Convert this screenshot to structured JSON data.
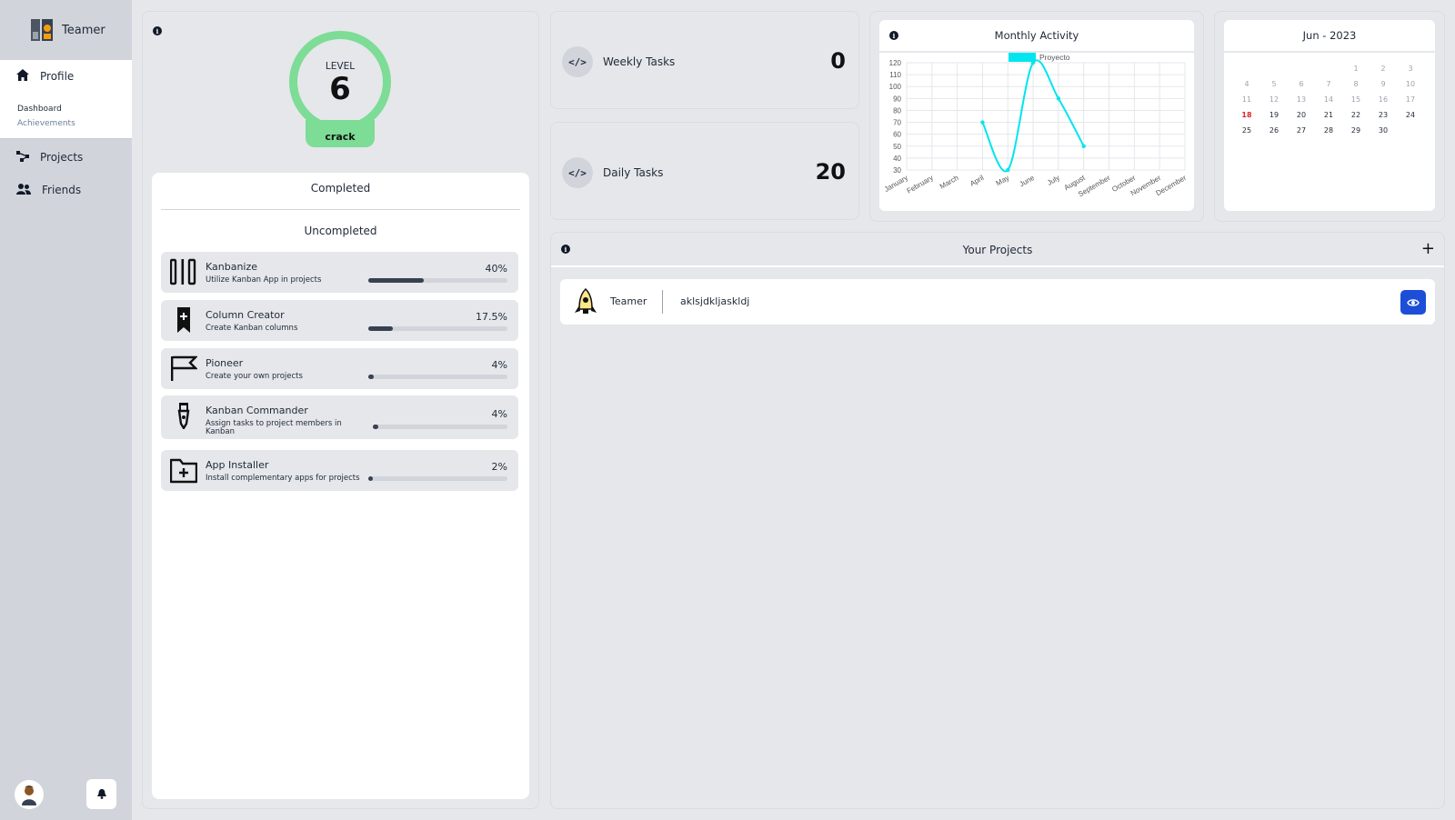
{
  "sidebar": {
    "brand": "Teamer",
    "nav": {
      "profile": "Profile",
      "dashboard": "Dashboard",
      "achievements": "Achievements",
      "projects": "Projects",
      "friends": "Friends"
    }
  },
  "level": {
    "label": "LEVEL",
    "value": "6",
    "rank": "crack"
  },
  "achievements": {
    "tabs": {
      "completed": "Completed",
      "uncompleted": "Uncompleted"
    },
    "items": [
      {
        "title": "Kanbanize",
        "desc": "Utilize Kanban App in projects",
        "pct": "40%",
        "progress": 0.4,
        "icon": "kanban-columns-icon"
      },
      {
        "title": "Column Creator",
        "desc": "Create Kanban columns",
        "pct": "17.5%",
        "progress": 0.175,
        "icon": "bookmark-plus-icon"
      },
      {
        "title": "Pioneer",
        "desc": "Create your own projects",
        "pct": "4%",
        "progress": 0.04,
        "icon": "flag-icon"
      },
      {
        "title": "Kanban Commander",
        "desc": "Assign tasks to project members in Kanban",
        "pct": "4%",
        "progress": 0.04,
        "icon": "medal-icon"
      },
      {
        "title": "App Installer",
        "desc": "Install complementary apps for projects",
        "pct": "2%",
        "progress": 0.02,
        "icon": "folder-plus-icon"
      }
    ]
  },
  "tasks": {
    "weekly": {
      "label": "Weekly Tasks",
      "value": "0"
    },
    "daily": {
      "label": "Daily Tasks",
      "value": "20"
    }
  },
  "chart_data": {
    "type": "line",
    "title": "Monthly Activity",
    "x": [
      "January",
      "February",
      "March",
      "April",
      "May",
      "June",
      "July",
      "August",
      "September",
      "October",
      "November",
      "December"
    ],
    "series": [
      {
        "name": "Proyecto",
        "values": [
          null,
          null,
          null,
          70,
          30,
          120,
          90,
          50,
          null,
          null,
          null,
          null
        ]
      }
    ],
    "ylim": [
      30,
      120
    ],
    "yticks": [
      30,
      40,
      50,
      60,
      70,
      80,
      90,
      100,
      110,
      120
    ],
    "grid": true,
    "legend": "top",
    "color": "#00e5ee"
  },
  "calendar": {
    "title": "Jun - 2023",
    "today": 18,
    "weeks": [
      [
        "",
        "",
        "",
        "",
        "1",
        "2",
        "3"
      ],
      [
        "4",
        "5",
        "6",
        "7",
        "8",
        "9",
        "10"
      ],
      [
        "11",
        "12",
        "13",
        "14",
        "15",
        "16",
        "17"
      ],
      [
        "18",
        "19",
        "20",
        "21",
        "22",
        "23",
        "24"
      ],
      [
        "25",
        "26",
        "27",
        "28",
        "29",
        "30",
        ""
      ]
    ]
  },
  "projects": {
    "title": "Your Projects",
    "add": "+",
    "items": [
      {
        "name": "Teamer",
        "desc": "aklsjdkljaskldj"
      }
    ]
  },
  "colors": {
    "accent": "#7ddc95",
    "chart_line": "#00e5ee",
    "view_button": "#1d4ed8",
    "today": "#dc2626"
  }
}
